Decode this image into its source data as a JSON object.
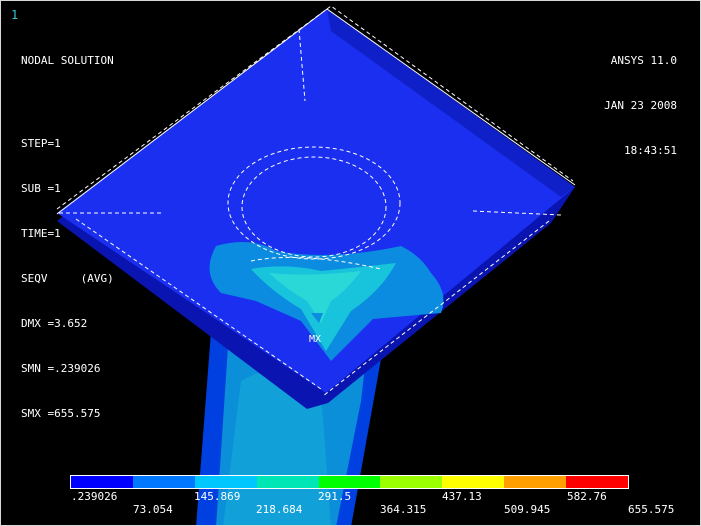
{
  "window_number": "1",
  "info": {
    "title": "NODAL SOLUTION",
    "step": "STEP=1",
    "sub": "SUB =1",
    "time": "TIME=1",
    "result": "SEQV     (AVG)",
    "dmx": "DMX =3.652",
    "smn": "SMN =.239026",
    "smx": "SMX =655.575"
  },
  "brand": {
    "product": "ANSYS 11.0",
    "date": "JAN 23 2008",
    "time": "18:43:51"
  },
  "max_marker": "MX",
  "legend": {
    "colors": [
      "#0000ff",
      "#0078ff",
      "#00c8ff",
      "#00e6b4",
      "#00ff00",
      "#9bff00",
      "#ffff00",
      "#ffa000",
      "#ff0000"
    ],
    "labels_row1": [
      ".239026",
      "145.869",
      "291.5",
      "437.13",
      "582.76"
    ],
    "labels_row2": [
      "73.054",
      "218.684",
      "364.315",
      "509.945",
      "655.575"
    ]
  }
}
